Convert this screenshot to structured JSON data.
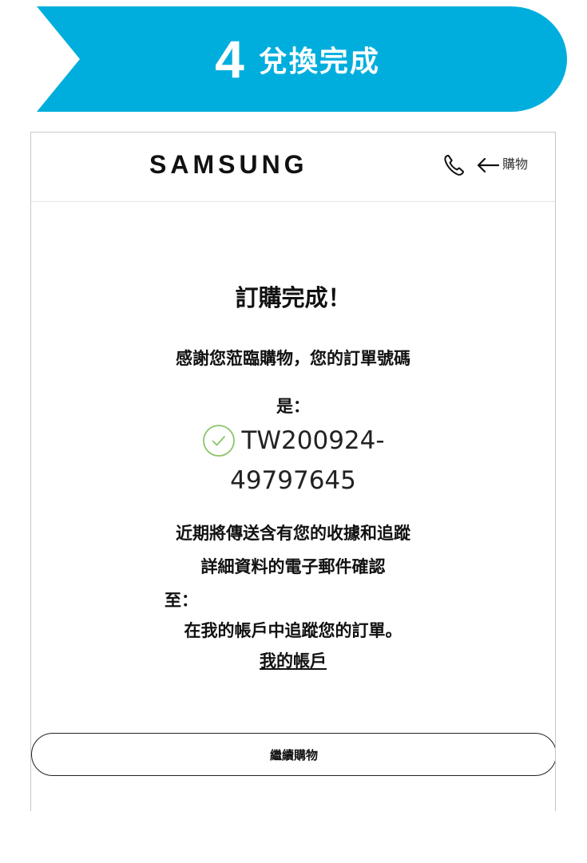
{
  "banner": {
    "step_number": "4",
    "step_title": "兌換完成",
    "color": "#00aedd"
  },
  "header": {
    "logo": "SAMSUNG",
    "phone_icon": "phone-icon",
    "back_icon": "arrow-left-icon",
    "back_label": "購物"
  },
  "confirmation": {
    "title": "訂購完成！",
    "thanks": "感謝您蒞臨購物，您的訂單號碼",
    "is_label": "是：",
    "check_icon": "check-circle-icon",
    "check_color": "#8cc56a",
    "order_number_line1": "TW200924-",
    "order_number_line2": "49797645",
    "note_line1": "近期將傳送含有您的收據和追蹤",
    "note_line2": "詳細資料的電子郵件確認",
    "to_label": "至：",
    "track_line": "在我的帳戶中追蹤您的訂單。",
    "account_link": "我的帳戶"
  },
  "actions": {
    "continue_label": "繼續購物"
  }
}
